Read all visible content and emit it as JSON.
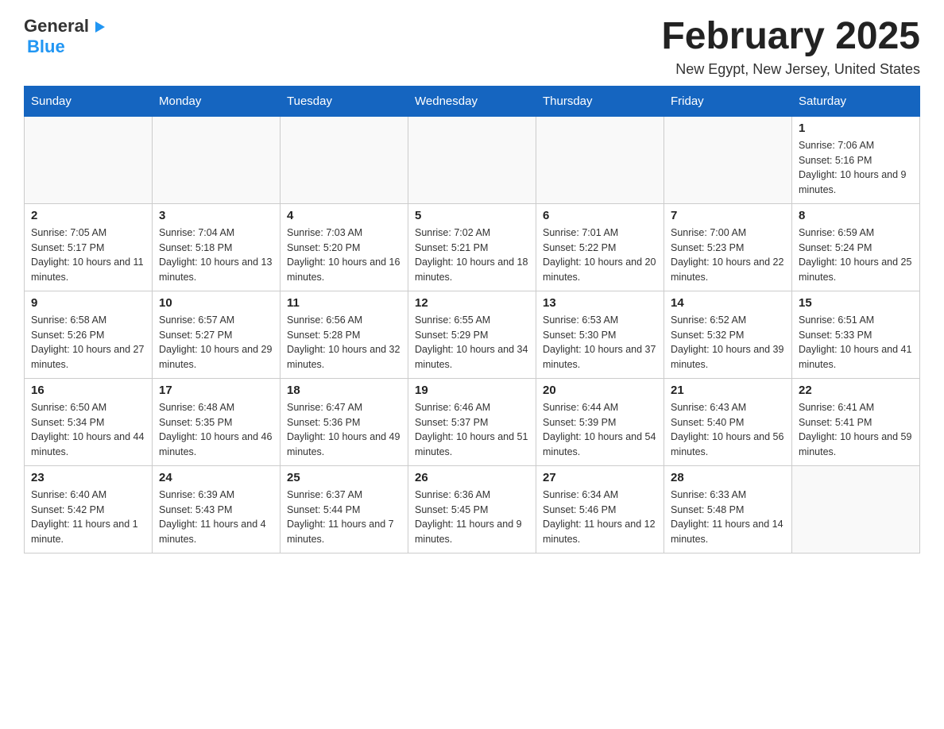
{
  "header": {
    "logo": {
      "general": "General",
      "triangle": "▶",
      "blue": "Blue"
    },
    "title": "February 2025",
    "location": "New Egypt, New Jersey, United States"
  },
  "weekdays": [
    "Sunday",
    "Monday",
    "Tuesday",
    "Wednesday",
    "Thursday",
    "Friday",
    "Saturday"
  ],
  "weeks": [
    [
      {
        "day": "",
        "info": ""
      },
      {
        "day": "",
        "info": ""
      },
      {
        "day": "",
        "info": ""
      },
      {
        "day": "",
        "info": ""
      },
      {
        "day": "",
        "info": ""
      },
      {
        "day": "",
        "info": ""
      },
      {
        "day": "1",
        "info": "Sunrise: 7:06 AM\nSunset: 5:16 PM\nDaylight: 10 hours and 9 minutes."
      }
    ],
    [
      {
        "day": "2",
        "info": "Sunrise: 7:05 AM\nSunset: 5:17 PM\nDaylight: 10 hours and 11 minutes."
      },
      {
        "day": "3",
        "info": "Sunrise: 7:04 AM\nSunset: 5:18 PM\nDaylight: 10 hours and 13 minutes."
      },
      {
        "day": "4",
        "info": "Sunrise: 7:03 AM\nSunset: 5:20 PM\nDaylight: 10 hours and 16 minutes."
      },
      {
        "day": "5",
        "info": "Sunrise: 7:02 AM\nSunset: 5:21 PM\nDaylight: 10 hours and 18 minutes."
      },
      {
        "day": "6",
        "info": "Sunrise: 7:01 AM\nSunset: 5:22 PM\nDaylight: 10 hours and 20 minutes."
      },
      {
        "day": "7",
        "info": "Sunrise: 7:00 AM\nSunset: 5:23 PM\nDaylight: 10 hours and 22 minutes."
      },
      {
        "day": "8",
        "info": "Sunrise: 6:59 AM\nSunset: 5:24 PM\nDaylight: 10 hours and 25 minutes."
      }
    ],
    [
      {
        "day": "9",
        "info": "Sunrise: 6:58 AM\nSunset: 5:26 PM\nDaylight: 10 hours and 27 minutes."
      },
      {
        "day": "10",
        "info": "Sunrise: 6:57 AM\nSunset: 5:27 PM\nDaylight: 10 hours and 29 minutes."
      },
      {
        "day": "11",
        "info": "Sunrise: 6:56 AM\nSunset: 5:28 PM\nDaylight: 10 hours and 32 minutes."
      },
      {
        "day": "12",
        "info": "Sunrise: 6:55 AM\nSunset: 5:29 PM\nDaylight: 10 hours and 34 minutes."
      },
      {
        "day": "13",
        "info": "Sunrise: 6:53 AM\nSunset: 5:30 PM\nDaylight: 10 hours and 37 minutes."
      },
      {
        "day": "14",
        "info": "Sunrise: 6:52 AM\nSunset: 5:32 PM\nDaylight: 10 hours and 39 minutes."
      },
      {
        "day": "15",
        "info": "Sunrise: 6:51 AM\nSunset: 5:33 PM\nDaylight: 10 hours and 41 minutes."
      }
    ],
    [
      {
        "day": "16",
        "info": "Sunrise: 6:50 AM\nSunset: 5:34 PM\nDaylight: 10 hours and 44 minutes."
      },
      {
        "day": "17",
        "info": "Sunrise: 6:48 AM\nSunset: 5:35 PM\nDaylight: 10 hours and 46 minutes."
      },
      {
        "day": "18",
        "info": "Sunrise: 6:47 AM\nSunset: 5:36 PM\nDaylight: 10 hours and 49 minutes."
      },
      {
        "day": "19",
        "info": "Sunrise: 6:46 AM\nSunset: 5:37 PM\nDaylight: 10 hours and 51 minutes."
      },
      {
        "day": "20",
        "info": "Sunrise: 6:44 AM\nSunset: 5:39 PM\nDaylight: 10 hours and 54 minutes."
      },
      {
        "day": "21",
        "info": "Sunrise: 6:43 AM\nSunset: 5:40 PM\nDaylight: 10 hours and 56 minutes."
      },
      {
        "day": "22",
        "info": "Sunrise: 6:41 AM\nSunset: 5:41 PM\nDaylight: 10 hours and 59 minutes."
      }
    ],
    [
      {
        "day": "23",
        "info": "Sunrise: 6:40 AM\nSunset: 5:42 PM\nDaylight: 11 hours and 1 minute."
      },
      {
        "day": "24",
        "info": "Sunrise: 6:39 AM\nSunset: 5:43 PM\nDaylight: 11 hours and 4 minutes."
      },
      {
        "day": "25",
        "info": "Sunrise: 6:37 AM\nSunset: 5:44 PM\nDaylight: 11 hours and 7 minutes."
      },
      {
        "day": "26",
        "info": "Sunrise: 6:36 AM\nSunset: 5:45 PM\nDaylight: 11 hours and 9 minutes."
      },
      {
        "day": "27",
        "info": "Sunrise: 6:34 AM\nSunset: 5:46 PM\nDaylight: 11 hours and 12 minutes."
      },
      {
        "day": "28",
        "info": "Sunrise: 6:33 AM\nSunset: 5:48 PM\nDaylight: 11 hours and 14 minutes."
      },
      {
        "day": "",
        "info": ""
      }
    ]
  ]
}
